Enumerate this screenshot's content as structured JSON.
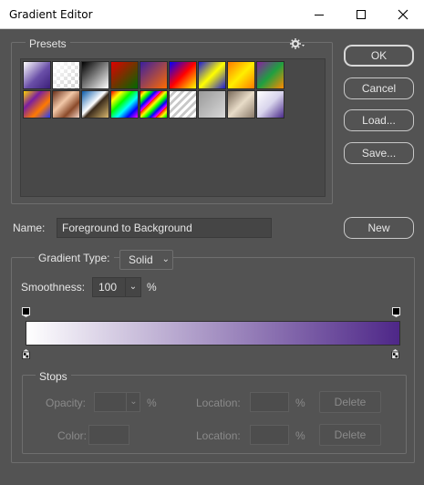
{
  "window": {
    "title": "Gradient Editor",
    "controls": [
      "minimize",
      "maximize",
      "close"
    ]
  },
  "presets": {
    "label": "Presets",
    "menu_icon": "gear-icon",
    "swatches": [
      {
        "name": "foreground-to-background",
        "css": "linear-gradient(135deg,#ffffff 0%,#6a4fa8 55%,#3b1f7a 100%)"
      },
      {
        "name": "foreground-to-transparent",
        "css": "linear-gradient(135deg,#ffffff 0%,rgba(255,255,255,0) 100%)"
      },
      {
        "name": "black-white",
        "css": "linear-gradient(135deg,#000000 0%,#ffffff 100%)"
      },
      {
        "name": "red-green",
        "css": "linear-gradient(135deg,#e00000 0%,#006a00 100%)"
      },
      {
        "name": "violet-orange",
        "css": "linear-gradient(135deg,#3a1fa0 0%,#ff6a00 100%)"
      },
      {
        "name": "blue-red-yellow",
        "css": "linear-gradient(135deg,#0000ff 0%,#ff0000 50%,#ffff00 100%)"
      },
      {
        "name": "blue-yellow-blue",
        "css": "linear-gradient(135deg,#1d1bd8 0%,#ffff00 50%,#1d1bd8 100%)"
      },
      {
        "name": "orange-yellow-orange",
        "css": "linear-gradient(135deg,#ff7a00 0%,#ffee00 50%,#ff7a00 100%)"
      },
      {
        "name": "violet-green-orange",
        "css": "linear-gradient(135deg,#8a1fa0 0%,#1fa040 50%,#ff8a00 100%)"
      },
      {
        "name": "yellow-violet-orange-blue",
        "css": "linear-gradient(135deg,#ffd400 0%,#7a1fa0 33%,#ff7a00 66%,#1f3aff 100%)"
      },
      {
        "name": "copper",
        "css": "linear-gradient(135deg,#6a2f1a 0%,#f2c8a8 40%,#8a4a2a 70%,#f4d4c4 100%)"
      },
      {
        "name": "chrome",
        "css": "linear-gradient(135deg,#0a5aa8 0%,#ffffff 45%,#3a2a1a 55%,#d8b870 100%)"
      },
      {
        "name": "spectrum",
        "css": "linear-gradient(135deg,#ff0000 0%,#ffff00 20%,#00ff00 40%,#00ffff 60%,#0000ff 80%,#ff00ff 100%)"
      },
      {
        "name": "transparent-rainbow",
        "css": "repeating-linear-gradient(135deg,#ff0000 0px,#ffff00 4px,#00ff00 8px,#0000ff 12px,#ff00ff 16px)"
      },
      {
        "name": "transparent-stripes",
        "css": "repeating-linear-gradient(135deg,#ffffff 0px,#ffffff 3px,#c8c8c8 3px,#c8c8c8 6px)"
      },
      {
        "name": "neutral-density",
        "css": "linear-gradient(135deg,#9a9a9a 0%,#d8d8d8 100%)"
      },
      {
        "name": "sepia",
        "css": "linear-gradient(135deg,#7a6a5a 0%,#e8dcc8 50%,#8a7a6a 100%)"
      },
      {
        "name": "violet-white",
        "css": "linear-gradient(135deg,#ffffff 0%,#d8d4ec 50%,#4a2a8a 100%)"
      }
    ]
  },
  "buttons": {
    "ok": "OK",
    "cancel": "Cancel",
    "load": "Load...",
    "save": "Save...",
    "new": "New"
  },
  "name_field": {
    "label": "Name:",
    "value": "Foreground to Background"
  },
  "gradient_type": {
    "label": "Gradient Type:",
    "selected": "Solid"
  },
  "smoothness": {
    "label": "Smoothness:",
    "value": "100",
    "unit": "%"
  },
  "gradient": {
    "start_color": "#ffffff",
    "end_color": "#4e2788"
  },
  "stops": {
    "label": "Stops",
    "opacity_label": "Opacity:",
    "opacity_unit": "%",
    "opacity_location_label": "Location:",
    "opacity_location_unit": "%",
    "opacity_delete": "Delete",
    "color_label": "Color:",
    "color_location_label": "Location:",
    "color_location_unit": "%",
    "color_delete": "Delete"
  }
}
